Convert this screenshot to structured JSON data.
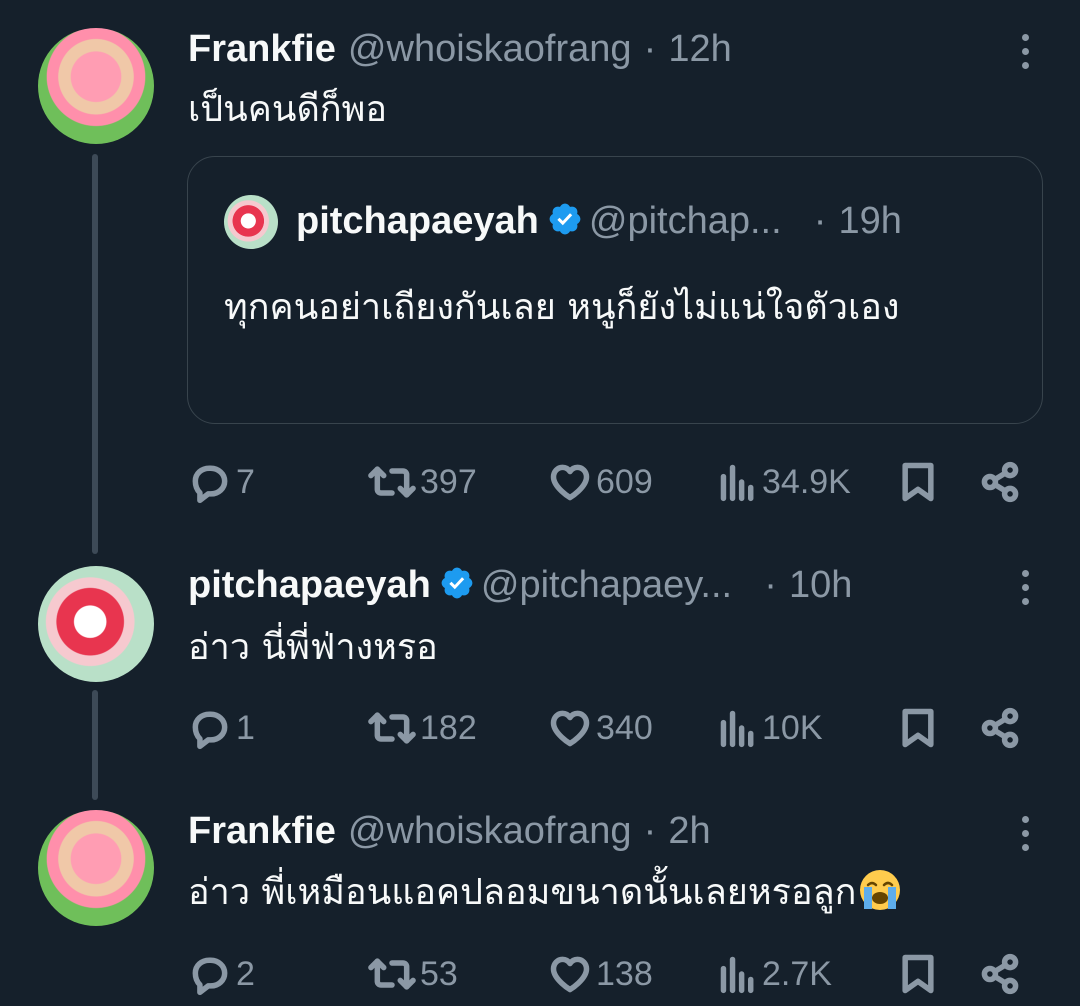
{
  "tweets": [
    {
      "name": "Frankfie",
      "handle": "@whoiskaofrang",
      "dot": "·",
      "time": "12h",
      "text": "เป็นคนดีก็พอ",
      "quote": {
        "name": "pitchapaeyah",
        "handle": "@pitchap...",
        "dot": "·",
        "time": "19h",
        "text": "ทุกคนอย่าเถียงกันเลย หนูก็ยังไม่แน่ใจตัวเอง"
      },
      "replies": "7",
      "retweets": "397",
      "likes": "609",
      "views": "34.9K"
    },
    {
      "name": "pitchapaeyah",
      "handle": "@pitchapaey...",
      "dot": "·",
      "time": "10h",
      "text": "อ่าว นี่พี่ฟ่างหรอ",
      "replies": "1",
      "retweets": "182",
      "likes": "340",
      "views": "10K"
    },
    {
      "name": "Frankfie",
      "handle": "@whoiskaofrang",
      "dot": "·",
      "time": "2h",
      "text": "อ่าว พี่เหมือนแอคปลอมขนาดนั้นเลยหรอลูก",
      "replies": "2",
      "retweets": "53",
      "likes": "138",
      "views": "2.7K"
    }
  ],
  "colors": {
    "background": "#15202b",
    "text": "#f7f9f9",
    "secondary": "#8b98a5",
    "verified": "#1d9bf0",
    "border": "#38444d"
  },
  "icons": [
    "reply-icon",
    "retweet-icon",
    "like-icon",
    "views-icon",
    "bookmark-icon",
    "share-icon",
    "verified-icon",
    "more-icon",
    "crying-emoji"
  ]
}
